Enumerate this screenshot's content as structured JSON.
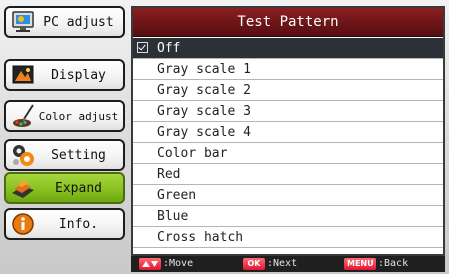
{
  "menu": {
    "items": [
      {
        "label": "PC adjust",
        "icon": "monitor-icon",
        "active": false
      },
      {
        "label": "Display",
        "icon": "display-icon",
        "active": false
      },
      {
        "label": "Color adjust",
        "icon": "paint-brush-icon",
        "active": false
      },
      {
        "label": "Setting",
        "icon": "gears-icon",
        "active": false
      },
      {
        "label": "Expand",
        "icon": "expand-hand-icon",
        "active": true
      },
      {
        "label": "Info.",
        "icon": "info-icon",
        "active": false
      }
    ]
  },
  "panel": {
    "title": "Test Pattern",
    "selected": "Off",
    "options": [
      "Off",
      "Gray scale 1",
      "Gray scale 2",
      "Gray scale 3",
      "Gray scale 4",
      "Color bar",
      "Red",
      "Green",
      "Blue",
      "Cross hatch"
    ]
  },
  "footer": {
    "move_text": ":Move",
    "ok_key": "OK",
    "next_text": ":Next",
    "menu_key": "MENU",
    "back_text": ":Back"
  },
  "colors": {
    "title_bar": "#6a1416",
    "active_menu": "#88c11f",
    "selected_row": "#2c3037",
    "key_red": "#e4142e"
  }
}
